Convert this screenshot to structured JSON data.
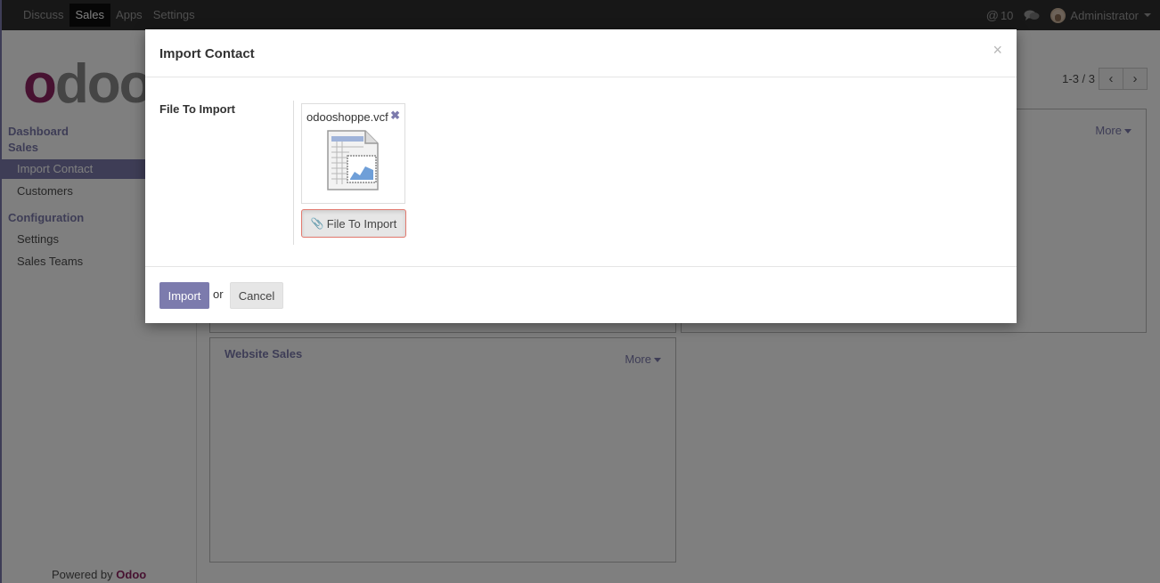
{
  "topbar": {
    "menu": [
      "Discuss",
      "Sales",
      "Apps",
      "Settings"
    ],
    "active_menu": "Sales",
    "mentions_count": "10",
    "user": "Administrator"
  },
  "sidebar": {
    "logo": {
      "first": "o",
      "rest": "doo"
    },
    "section_dashboard": "Dashboard",
    "section_sales": "Sales",
    "items_sales": [
      "Import Contact",
      "Customers"
    ],
    "section_configuration": "Configuration",
    "items_config": [
      "Settings",
      "Sales Teams"
    ],
    "powered_by": "Powered by",
    "powered_brand": "Odoo"
  },
  "content": {
    "pager": "1-3 / 3",
    "cards": [
      {
        "title": "",
        "more": "More"
      },
      {
        "title": "Website Sales",
        "more": "More"
      }
    ]
  },
  "modal": {
    "title": "Import Contact",
    "close": "×",
    "field_label": "File To Import",
    "file_name": "odooshoppe.vcf",
    "remove_icon": "✖",
    "upload_button": "File To Import",
    "footer": {
      "primary": "Import",
      "or": "or",
      "cancel": "Cancel"
    }
  },
  "colors": {
    "brand": "#7c7bad",
    "odoo_purple": "#8f2463",
    "topbar": "#2f2f2f"
  }
}
